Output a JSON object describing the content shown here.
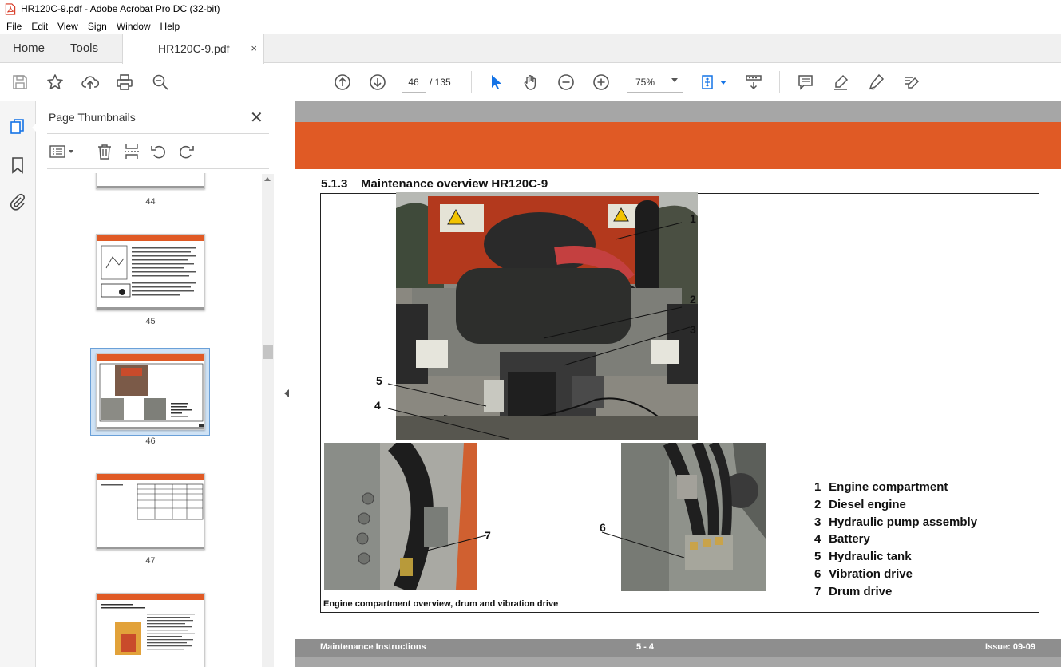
{
  "window": {
    "title": "HR120C-9.pdf - Adobe Acrobat Pro DC (32-bit)"
  },
  "menu": [
    "File",
    "Edit",
    "View",
    "Sign",
    "Window",
    "Help"
  ],
  "tabs": {
    "home": "Home",
    "tools": "Tools",
    "document": "HR120C-9.pdf",
    "close": "×"
  },
  "toolbar": {
    "current_page": "46",
    "total_pages": "/ 135",
    "zoom": "75%"
  },
  "panel": {
    "title": "Page Thumbnails",
    "close": "✕",
    "thumbnails": [
      {
        "label": "44"
      },
      {
        "label": "45"
      },
      {
        "label": "46",
        "selected": true
      },
      {
        "label": "47"
      },
      {
        "label": ""
      }
    ]
  },
  "document": {
    "section_number": "5.1.3",
    "section_title": "Maintenance overview HR120C-9",
    "caption": "Engine compartment overview, drum and vibration drive",
    "callouts": [
      "1",
      "2",
      "3",
      "4",
      "5",
      "6",
      "7"
    ],
    "legend": [
      {
        "num": "1",
        "label": "Engine compartment"
      },
      {
        "num": "2",
        "label": "Diesel engine"
      },
      {
        "num": "3",
        "label": "Hydraulic pump assembly"
      },
      {
        "num": "4",
        "label": "Battery"
      },
      {
        "num": "5",
        "label": "Hydraulic tank"
      },
      {
        "num": "6",
        "label": "Vibration drive"
      },
      {
        "num": "7",
        "label": "Drum drive"
      }
    ],
    "footer": {
      "left": "Maintenance Instructions",
      "center": "5 - 4",
      "right": "Issue: 09-09"
    }
  },
  "colors": {
    "orange": "#e05a25",
    "accent_blue": "#1473e6",
    "panel_bg": "#f5f5f5"
  }
}
